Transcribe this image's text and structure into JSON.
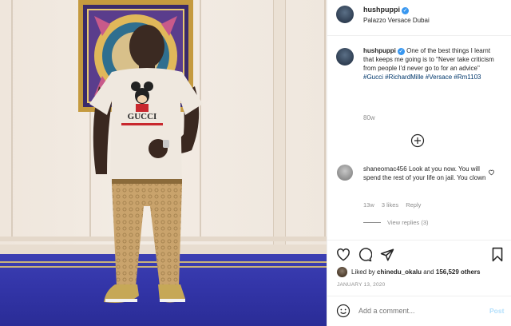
{
  "header": {
    "username": "hushpuppi",
    "location": "Palazzo Versace Dubai",
    "more_icon": "more-horizontal-icon"
  },
  "caption": {
    "username": "hushpuppi",
    "text": "One of the best things I learnt that keeps me going is to \"Never take criticism from people I'd never go to for an advice\"",
    "hashtags": "#Gucci #RichardMille #Versace #Rm1103",
    "age": "80w"
  },
  "load_more_icon": "plus-circle-icon",
  "comment": {
    "username": "shaneomac456",
    "text": "Look at you now. You will spend the rest of your life on jail. You clown",
    "age": "13w",
    "likes": "3 likes",
    "reply": "Reply",
    "view_replies": "View replies (3)"
  },
  "actions": {
    "like_icon": "heart-icon",
    "comment_icon": "comment-icon",
    "share_icon": "send-icon",
    "save_icon": "bookmark-icon"
  },
  "likes": {
    "prefix": "Liked by",
    "user": "chinedu_okalu",
    "and": "and",
    "count": "156,529 others"
  },
  "date": "JANUARY 13, 2020",
  "add_comment": {
    "placeholder": "Add a comment...",
    "post_label": "Post",
    "emoji_icon": "emoji-icon"
  },
  "photo": {
    "shirt_text": "GUCCI"
  },
  "colors": {
    "link": "#00376b",
    "post_button": "#b2dffc",
    "verified": "#3897f0",
    "carpet": "#3335a8"
  }
}
